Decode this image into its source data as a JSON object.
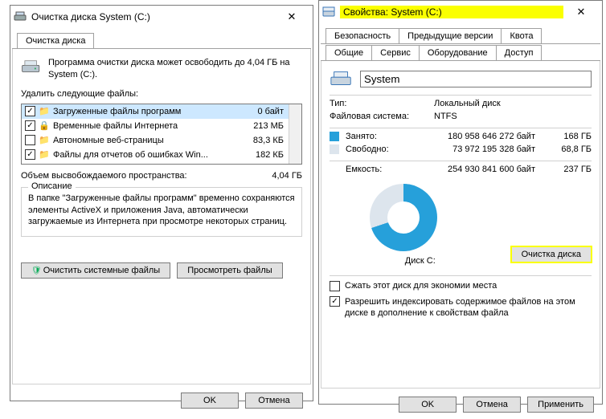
{
  "cleanup": {
    "title": "Очистка диска System (C:)",
    "tab": "Очистка диска",
    "intro": "Программа очистки диска может освободить до 4,04 ГБ на System (C:).",
    "delete_label": "Удалить следующие файлы:",
    "items": [
      {
        "checked": true,
        "icon": "folder",
        "name": "Загруженные файлы программ",
        "size": "0 байт"
      },
      {
        "checked": true,
        "icon": "lock",
        "name": "Временные файлы Интернета",
        "size": "213 МБ"
      },
      {
        "checked": false,
        "icon": "folder",
        "name": "Автономные веб-страницы",
        "size": "83,3 КБ"
      },
      {
        "checked": true,
        "icon": "folder",
        "name": "Файлы для отчетов об ошибках Win...",
        "size": "182 КБ"
      }
    ],
    "free_label": "Объем высвобождаемого пространства:",
    "free_value": "4,04 ГБ",
    "group_title": "Описание",
    "group_text": "В папке \"Загруженные файлы программ\" временно сохраняются элементы ActiveX и приложения Java, автоматически загружаемые из Интернета при просмотре некоторых страниц.",
    "btn_sys": "Очистить системные файлы",
    "btn_view": "Просмотреть файлы",
    "ok": "OK",
    "cancel": "Отмена"
  },
  "props": {
    "title": "Свойства: System (C:)",
    "tabs_top": [
      "Безопасность",
      "Предыдущие версии",
      "Квота"
    ],
    "tabs_bottom": [
      "Общие",
      "Сервис",
      "Оборудование",
      "Доступ"
    ],
    "active_tab": "Общие",
    "name": "System",
    "type_label": "Тип:",
    "type_value": "Локальный диск",
    "fs_label": "Файловая система:",
    "fs_value": "NTFS",
    "used_label": "Занято:",
    "used_bytes": "180 958 646 272 байт",
    "used_gb": "168 ГБ",
    "free_label": "Свободно:",
    "free_bytes": "73 972 195 328 байт",
    "free_gb": "68,8 ГБ",
    "cap_label": "Емкость:",
    "cap_bytes": "254 930 841 600 байт",
    "cap_gb": "237 ГБ",
    "disk_caption": "Диск C:",
    "btn_cleanup": "Очистка диска",
    "chk_compress": "Сжать этот диск для экономии места",
    "chk_index": "Разрешить индексировать содержимое файлов на этом диске в дополнение к свойствам файла",
    "ok": "OK",
    "cancel": "Отмена",
    "apply": "Применить"
  },
  "chart_data": {
    "type": "pie",
    "title": "Диск C:",
    "series": [
      {
        "name": "Занято",
        "bytes": 180958646272,
        "label": "168 ГБ",
        "color": "#26a0da"
      },
      {
        "name": "Свободно",
        "bytes": 73972195328,
        "label": "68,8 ГБ",
        "color": "#dde5ed"
      }
    ],
    "total_bytes": 254930841600,
    "total_label": "237 ГБ"
  }
}
